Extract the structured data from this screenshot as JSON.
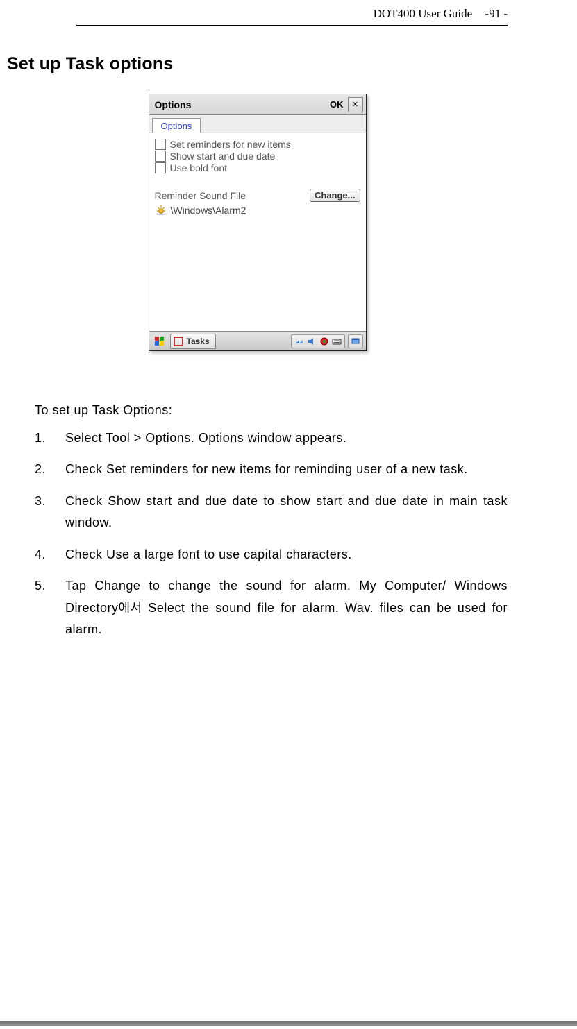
{
  "header": {
    "doc_title": "DOT400 User Guide",
    "page_number": "-91 -"
  },
  "section_title": "Set up Task options",
  "dialog": {
    "title": "Options",
    "ok_label": "OK",
    "tab_label": "Options",
    "checkboxes": [
      "Set reminders for new items",
      "Show start and due date",
      "Use bold font"
    ],
    "reminder_label": "Reminder Sound File",
    "change_label": "Change...",
    "sound_path": "\\Windows\\Alarm2",
    "task_button": "Tasks"
  },
  "instructions": {
    "intro": "To set up Task Options:",
    "steps": [
      "Select Tool > Options. Options window appears.",
      "Check Set reminders for new items for reminding user of a new task.",
      "Check Show start and due date to show start and due date in main task window.",
      "Check Use a large font to use capital characters.",
      "Tap Change to change the sound for alarm. My Computer/ Windows Directory에서 Select the sound file for alarm. Wav. files can be used for alarm."
    ]
  }
}
